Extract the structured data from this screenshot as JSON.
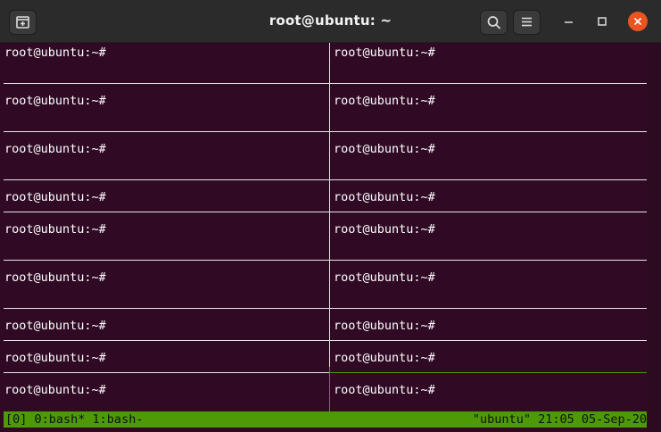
{
  "window": {
    "title": "root@ubuntu: ~",
    "icons": {
      "new_tab": "new-tab-icon",
      "search": "search-icon",
      "menu": "hamburger-menu-icon",
      "minimize": "minimize-icon",
      "maximize": "maximize-icon",
      "close": "close-icon"
    },
    "colors": {
      "titlebar": "#2b2b2b",
      "terminal_bg": "#300a24",
      "close_button": "#e95420",
      "active_pane_border": "#4e9a06",
      "status_bar": "#4e9a06"
    }
  },
  "panes": [
    {
      "prompt": "root@ubuntu:~#"
    },
    {
      "prompt": "root@ubuntu:~#"
    },
    {
      "prompt": "root@ubuntu:~#"
    },
    {
      "prompt": "root@ubuntu:~#"
    },
    {
      "prompt": "root@ubuntu:~#"
    },
    {
      "prompt": "root@ubuntu:~#"
    },
    {
      "prompt": "root@ubuntu:~#"
    },
    {
      "prompt": "root@ubuntu:~#"
    },
    {
      "prompt": "root@ubuntu:~#"
    },
    {
      "prompt": "root@ubuntu:~#"
    },
    {
      "prompt": "root@ubuntu:~#"
    },
    {
      "prompt": "root@ubuntu:~#"
    },
    {
      "prompt": "root@ubuntu:~#"
    },
    {
      "prompt": "root@ubuntu:~#"
    },
    {
      "prompt": "root@ubuntu:~#"
    },
    {
      "prompt": "root@ubuntu:~#"
    },
    {
      "prompt": "root@ubuntu:~#"
    },
    {
      "prompt": "root@ubuntu:~#"
    }
  ],
  "status_bar": {
    "session": "[0]",
    "windows": "0:bash* 1:bash-",
    "right": "\"ubuntu\" 21:05 05-Sep-20"
  }
}
